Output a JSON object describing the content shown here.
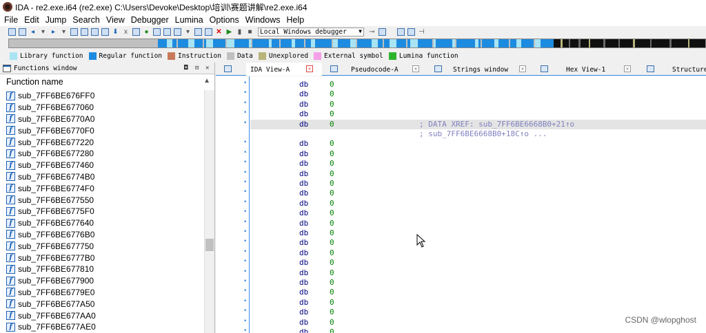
{
  "window": {
    "title": "IDA - re2.exe.i64 (re2.exe) C:\\Users\\Devoke\\Desktop\\培训\\赛题讲解\\re2.exe.i64"
  },
  "menu": [
    "File",
    "Edit",
    "Jump",
    "Search",
    "View",
    "Debugger",
    "Lumina",
    "Options",
    "Windows",
    "Help"
  ],
  "toolbar": {
    "debugger_select": "Local Windows debugger"
  },
  "legend": [
    {
      "label": "Library function",
      "color": "#a8e4f4"
    },
    {
      "label": "Regular function",
      "color": "#1d8be0"
    },
    {
      "label": "Instruction",
      "color": "#c87a5a"
    },
    {
      "label": "Data",
      "color": "#c0c0c0"
    },
    {
      "label": "Unexplored",
      "color": "#b8b47a"
    },
    {
      "label": "External symbol",
      "color": "#f4a0e8"
    },
    {
      "label": "Lumina function",
      "color": "#2db42d"
    }
  ],
  "functions_window": {
    "title": "Functions window",
    "column_header": "Function name",
    "items": [
      "sub_7FF6BE676FF0",
      "sub_7FF6BE677060",
      "sub_7FF6BE6770A0",
      "sub_7FF6BE6770F0",
      "sub_7FF6BE677220",
      "sub_7FF6BE677280",
      "sub_7FF6BE677460",
      "sub_7FF6BE6774B0",
      "sub_7FF6BE6774F0",
      "sub_7FF6BE677550",
      "sub_7FF6BE6775F0",
      "sub_7FF6BE677640",
      "sub_7FF6BE6776B0",
      "sub_7FF6BE677750",
      "sub_7FF6BE6777B0",
      "sub_7FF6BE677810",
      "sub_7FF6BE677900",
      "sub_7FF6BE6779E0",
      "sub_7FF6BE677A50",
      "sub_7FF6BE677AA0",
      "sub_7FF6BE677AE0"
    ]
  },
  "tabs": [
    {
      "label": "IDA View-A",
      "active": true
    },
    {
      "label": "Pseudocode-A",
      "active": false
    },
    {
      "label": "Strings window",
      "active": false
    },
    {
      "label": "Hex View-1",
      "active": false
    },
    {
      "label": "Structure",
      "active": false
    }
  ],
  "ida_view": {
    "mnemonic": "db",
    "operand": "0",
    "xref_comment_1": "; DATA XREF: sub_7FF6BE6668B0+21↑o",
    "xref_comment_2": "; sub_7FF6BE6668B0+18C↑o  ..."
  },
  "watermark": "CSDN @wlopghost"
}
